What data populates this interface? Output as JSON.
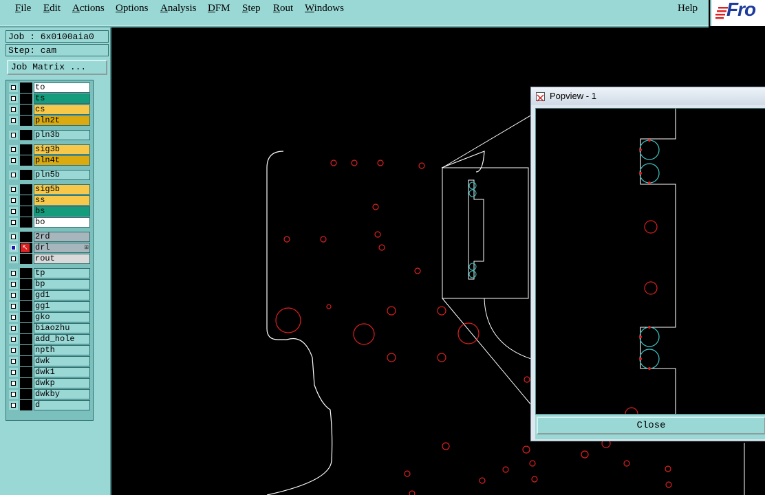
{
  "menu": {
    "items": [
      {
        "mnemonic": "F",
        "rest": "ile"
      },
      {
        "mnemonic": "E",
        "rest": "dit"
      },
      {
        "mnemonic": "A",
        "rest": "ctions"
      },
      {
        "mnemonic": "O",
        "rest": "ptions"
      },
      {
        "mnemonic": "A",
        "rest": "nalysis"
      },
      {
        "mnemonic": "D",
        "rest": "FM"
      },
      {
        "mnemonic": "S",
        "rest": "tep"
      },
      {
        "mnemonic": "R",
        "rest": "out"
      },
      {
        "mnemonic": "W",
        "rest": "indows"
      }
    ],
    "help": "Help"
  },
  "logo": {
    "text": "Fro"
  },
  "job": {
    "label": "Job : 6x0100aia0"
  },
  "step": {
    "label": "Step: cam"
  },
  "job_matrix_button": "Job Matrix ...",
  "layers": [
    {
      "name": "to",
      "color": "#ffffff"
    },
    {
      "name": "ts",
      "color": "#149c7c"
    },
    {
      "name": "cs",
      "color": "#f7c84a"
    },
    {
      "name": "pln2t",
      "color": "#dba910"
    },
    {
      "name": "pln3b",
      "color": "#9ad8d6"
    },
    {
      "name": "sig3b",
      "color": "#f7c84a"
    },
    {
      "name": "pln4t",
      "color": "#dba910"
    },
    {
      "name": "pln5b",
      "color": "#9ad8d6"
    },
    {
      "name": "sig5b",
      "color": "#f7c84a"
    },
    {
      "name": "ss",
      "color": "#f7c84a"
    },
    {
      "name": "bs",
      "color": "#149c7c"
    },
    {
      "name": "bo",
      "color": "#ffffff"
    },
    {
      "name": "2rd",
      "color": "#a6b6bc"
    },
    {
      "name": "drl",
      "color": "#a6b6bc",
      "active": true,
      "mark": "⊞"
    },
    {
      "name": "rout",
      "color": "#dadada"
    },
    {
      "name": "tp",
      "color": "#9ad8d6"
    },
    {
      "name": "bp",
      "color": "#9ad8d6"
    },
    {
      "name": "gd1",
      "color": "#9ad8d6"
    },
    {
      "name": "gg1",
      "color": "#9ad8d6"
    },
    {
      "name": "gko",
      "color": "#9ad8d6"
    },
    {
      "name": "biaozhu",
      "color": "#9ad8d6"
    },
    {
      "name": "add_hole",
      "color": "#9ad8d6"
    },
    {
      "name": "npth",
      "color": "#9ad8d6"
    },
    {
      "name": "dwk",
      "color": "#9ad8d6"
    },
    {
      "name": "dwk1",
      "color": "#9ad8d6"
    },
    {
      "name": "dwkp",
      "color": "#9ad8d6"
    },
    {
      "name": "dwkby",
      "color": "#9ad8d6"
    },
    {
      "name": "d",
      "color": "#9ad8d6"
    }
  ],
  "popview": {
    "title": "Popview - 1",
    "close_label": "Close"
  },
  "icons": {
    "affected": "arrow-icon",
    "window": "app-window-icon"
  },
  "colors": {
    "panel": "#9ad8d6",
    "board_outline": "#ffffff",
    "drill_hole": "#e02020",
    "slot": "#3fc6c6"
  }
}
